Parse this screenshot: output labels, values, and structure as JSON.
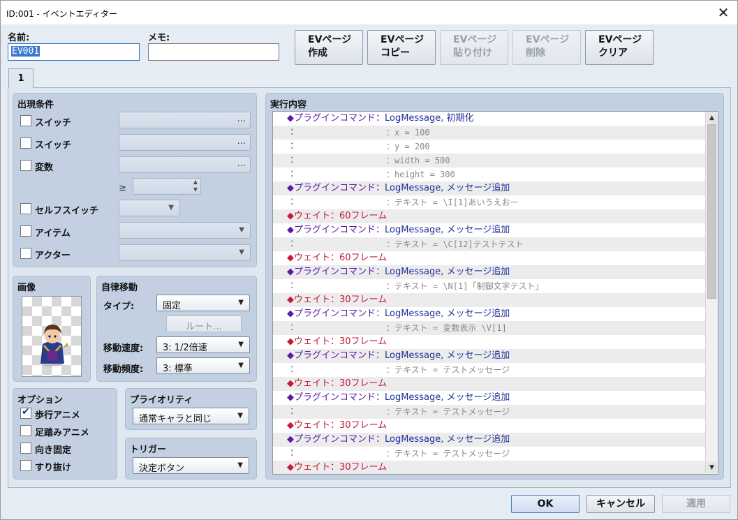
{
  "window": {
    "title": "ID:001 - イベントエディター",
    "close_glyph": "✕"
  },
  "header": {
    "name_label": "名前:",
    "name_value": "EV001",
    "memo_label": "メモ:",
    "memo_value": ""
  },
  "page_buttons": [
    {
      "line1": "EVページ",
      "line2": "作成"
    },
    {
      "line1": "EVページ",
      "line2": "コピー"
    },
    {
      "line1": "EVページ",
      "line2": "貼り付け"
    },
    {
      "line1": "EVページ",
      "line2": "削除"
    },
    {
      "line1": "EVページ",
      "line2": "クリア"
    }
  ],
  "tabs": [
    {
      "label": "1"
    }
  ],
  "conditions": {
    "title": "出現条件",
    "switch1_label": "スイッチ",
    "switch2_label": "スイッチ",
    "variable_label": "変数",
    "gte_symbol": "≥",
    "self_switch_label": "セルフスイッチ",
    "item_label": "アイテム",
    "actor_label": "アクター",
    "ellipsis": "..."
  },
  "image": {
    "title": "画像",
    "icon": "character-sprite-icon"
  },
  "movement": {
    "title": "自律移動",
    "type_label": "タイプ:",
    "type_value": "固定",
    "route_button": "ルート...",
    "speed_label": "移動速度:",
    "speed_value": "3: 1/2倍速",
    "freq_label": "移動頻度:",
    "freq_value": "3: 標準"
  },
  "options": {
    "title": "オプション",
    "walking": "歩行アニメ",
    "stepping": "足踏みアニメ",
    "direction_fix": "向き固定",
    "through": "すり抜け"
  },
  "priority": {
    "title": "プライオリティ",
    "value": "通常キャラと同じ"
  },
  "trigger": {
    "title": "トリガー",
    "value": "決定ボタン"
  },
  "contents": {
    "title": "実行内容",
    "lead_plugin": "◆プラグインコマンド：",
    "lead_wait": "◆ウェイト：",
    "cont": "：",
    "arg_prefix": "：",
    "rows": [
      {
        "kind": "plugin",
        "value": "LogMessage, 初期化"
      },
      {
        "kind": "arg",
        "value": "x = 100"
      },
      {
        "kind": "arg",
        "value": "y = 200"
      },
      {
        "kind": "arg",
        "value": "width = 500"
      },
      {
        "kind": "arg",
        "value": "height = 300"
      },
      {
        "kind": "plugin",
        "value": "LogMessage, メッセージ追加"
      },
      {
        "kind": "arg",
        "value": "テキスト = \\I[1]あいうえおー"
      },
      {
        "kind": "wait",
        "value": "60フレーム"
      },
      {
        "kind": "plugin",
        "value": "LogMessage, メッセージ追加"
      },
      {
        "kind": "arg",
        "value": "テキスト = \\C[12]テストテスト"
      },
      {
        "kind": "wait",
        "value": "60フレーム"
      },
      {
        "kind": "plugin",
        "value": "LogMessage, メッセージ追加"
      },
      {
        "kind": "arg",
        "value": "テキスト = \\N[1]「制御文字テスト」"
      },
      {
        "kind": "wait",
        "value": "30フレーム"
      },
      {
        "kind": "plugin",
        "value": "LogMessage, メッセージ追加"
      },
      {
        "kind": "arg",
        "value": "テキスト = 変数表示 \\V[1]"
      },
      {
        "kind": "wait",
        "value": "30フレーム"
      },
      {
        "kind": "plugin",
        "value": "LogMessage, メッセージ追加"
      },
      {
        "kind": "arg",
        "value": "テキスト = テストメッセージ"
      },
      {
        "kind": "wait",
        "value": "30フレーム"
      },
      {
        "kind": "plugin",
        "value": "LogMessage, メッセージ追加"
      },
      {
        "kind": "arg",
        "value": "テキスト = テストメッセージ"
      },
      {
        "kind": "wait",
        "value": "30フレーム"
      },
      {
        "kind": "plugin",
        "value": "LogMessage, メッセージ追加"
      },
      {
        "kind": "arg",
        "value": "テキスト = テストメッセージ"
      },
      {
        "kind": "wait",
        "value": "30フレーム"
      }
    ]
  },
  "footer": {
    "ok": "OK",
    "cancel": "キャンセル",
    "apply": "適用"
  }
}
